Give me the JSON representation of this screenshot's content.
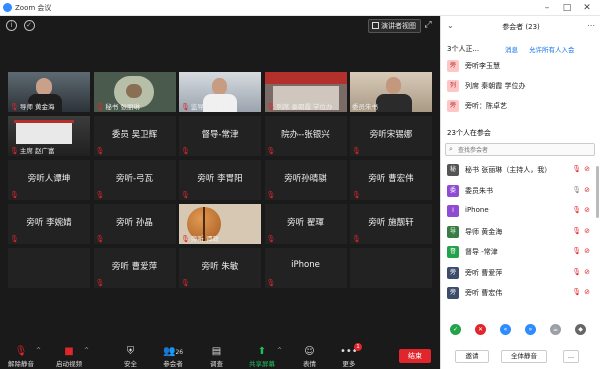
{
  "window": {
    "title": "Zoom 会议"
  },
  "top_bar": {
    "speaker_view_label": "演讲者视图"
  },
  "tiles": [
    {
      "kind": "video",
      "label": "导师 黄金海",
      "muted": true,
      "scene": "man-glasses"
    },
    {
      "kind": "video",
      "label": "秘书 张丽琳",
      "muted": true,
      "active": true,
      "scene": "animal"
    },
    {
      "kind": "video",
      "label": "监导人-对涛",
      "muted": true,
      "scene": "man-office"
    },
    {
      "kind": "video",
      "label": "列席 秦朝霞 学位办",
      "muted": true,
      "scene": "banner"
    },
    {
      "kind": "video",
      "label": "委员朱书",
      "muted": false,
      "scene": "man-room"
    },
    {
      "kind": "video",
      "label": "主席 赵广富",
      "muted": true,
      "scene": "lecture"
    },
    {
      "kind": "name",
      "label": "委员 吴卫辉",
      "muted": true
    },
    {
      "kind": "name",
      "label": "督导-常津",
      "muted": true
    },
    {
      "kind": "name",
      "label": "院办--张银兴",
      "muted": true
    },
    {
      "kind": "name",
      "label": "旁听宋锡娜",
      "muted": true
    },
    {
      "kind": "name",
      "label": "旁听人谭坤",
      "muted": true
    },
    {
      "kind": "name",
      "label": "旁听-弓瓦",
      "muted": true
    },
    {
      "kind": "name",
      "label": "旁听 李胃阳",
      "muted": true
    },
    {
      "kind": "name",
      "label": "旁听孙晴骐",
      "muted": true
    },
    {
      "kind": "name",
      "label": "旁听 曹宏伟",
      "muted": true
    },
    {
      "kind": "name",
      "label": "旁听 李婉婧",
      "muted": true
    },
    {
      "kind": "name",
      "label": "旁听 孙晶",
      "muted": true
    },
    {
      "kind": "video",
      "label": "旁听 谭政",
      "muted": true,
      "scene": "basketball"
    },
    {
      "kind": "name",
      "label": "旁听 翟琿",
      "muted": true
    },
    {
      "kind": "name",
      "label": "旁听 施靓轩",
      "muted": true
    },
    {
      "kind": "empty"
    },
    {
      "kind": "name",
      "label": "旁听 曹爱萍",
      "muted": true
    },
    {
      "kind": "name",
      "label": "旁听 朱敏",
      "muted": true
    },
    {
      "kind": "name",
      "label": "iPhone",
      "muted": true
    },
    {
      "kind": "empty"
    }
  ],
  "toolbar": {
    "unmute": "解除静音",
    "start_video": "启动视频",
    "security": "安全",
    "participants": "参会者",
    "participant_count": "26",
    "polls": "调查",
    "share_screen": "共享屏幕",
    "reactions": "表情",
    "more": "更多",
    "more_badge": "1",
    "leave": "结束"
  },
  "panel": {
    "title": "参会者 (23)",
    "waiting_header": "3个人正...",
    "message_link": "消息",
    "admit_all_link": "允许所有人入会",
    "waiting": [
      {
        "name": "旁听李玉慧",
        "avatar": "旁",
        "color": "#ffc6c6"
      },
      {
        "name": "列席 秦朝霞 学位办",
        "avatar": "列",
        "color": "#ffc6c6"
      },
      {
        "name": "旁听：陈卓艺",
        "avatar": "旁",
        "color": "#ffc6c6"
      }
    ],
    "in_meeting_header": "23个人在参会",
    "search_placeholder": "查找参会者",
    "participants": [
      {
        "name": "秘书 张丽琳（主持人，我）",
        "avatar": "秘",
        "color": "#555555",
        "mic": "muted",
        "video": "off"
      },
      {
        "name": "委员朱书",
        "avatar": "委",
        "color": "#8f4bd4",
        "mic": "on",
        "video": "off"
      },
      {
        "name": "iPhone",
        "avatar": "I",
        "color": "#8f4bd4",
        "mic": "muted",
        "video": "off"
      },
      {
        "name": "导师 黄金海",
        "avatar": "导",
        "color": "#3a7d44",
        "mic": "muted",
        "video": "off"
      },
      {
        "name": "督导 -常津",
        "avatar": "督",
        "color": "#22a34a",
        "mic": "muted",
        "video": "off"
      },
      {
        "name": "旁听 曹爱萍",
        "avatar": "旁",
        "color": "#3c4d6b",
        "mic": "muted",
        "video": "off"
      },
      {
        "name": "旁听 曹宏伟",
        "avatar": "旁",
        "color": "#3c4d6b",
        "mic": "muted",
        "video": "off"
      }
    ],
    "invite": "邀请",
    "mute_all": "全体静音",
    "more": "..."
  }
}
